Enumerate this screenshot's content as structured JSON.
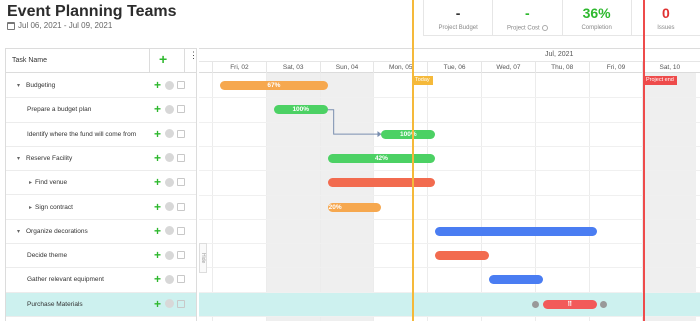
{
  "header": {
    "title": "Event Planning Teams",
    "date_range": "Jul 06, 2021 - Jul 09, 2021"
  },
  "stats": [
    {
      "value": "-",
      "label": "Project Budget",
      "color": "#333333"
    },
    {
      "value": "-",
      "label": "Project Cost",
      "color": "#2eb82e"
    },
    {
      "value": "36%",
      "label": "Completion",
      "color": "#2eb82e"
    },
    {
      "value": "0",
      "label": "Issues",
      "color": "#e03131"
    }
  ],
  "grid": {
    "header_label": "Task Name",
    "add_icon": "+",
    "menu_icon": "⋮",
    "rows": [
      {
        "name": "Budgeting",
        "level": 0,
        "caret": "▾"
      },
      {
        "name": "Prepare a budget plan",
        "level": 1,
        "caret": ""
      },
      {
        "name": "Identify where the fund will come from",
        "level": 1,
        "caret": ""
      },
      {
        "name": "Reserve Facility",
        "level": 0,
        "caret": "▾"
      },
      {
        "name": "Find venue",
        "level": 1,
        "caret": "▸"
      },
      {
        "name": "Sign contract",
        "level": 1,
        "caret": "▸"
      },
      {
        "name": "Organize decorations",
        "level": 0,
        "caret": "▾"
      },
      {
        "name": "Decide theme",
        "level": 1,
        "caret": ""
      },
      {
        "name": "Gather relevant equipment",
        "level": 1,
        "caret": ""
      },
      {
        "name": "Purchase Materials",
        "level": 1,
        "caret": "",
        "selected": true
      }
    ]
  },
  "timeline": {
    "month": "Jul, 2021",
    "days": [
      "Fri, 02",
      "Sat, 03",
      "Sun, 04",
      "Mon, 05",
      "Tue, 06",
      "Wed, 07",
      "Thu, 08",
      "Fri, 09",
      "Sat, 10"
    ],
    "weekend_days": [
      1,
      2,
      8
    ],
    "today_label": "Today",
    "project_end_label": "Project end",
    "hide_label": "Hide",
    "bars": [
      {
        "row": 0,
        "start": 0.15,
        "end": 2.15,
        "color": "orange",
        "label": "67%"
      },
      {
        "row": 1,
        "start": 1.15,
        "end": 2.15,
        "color": "green",
        "label": "100%"
      },
      {
        "row": 2,
        "start": 3.15,
        "end": 4.15,
        "color": "green",
        "label": "100%"
      },
      {
        "row": 3,
        "start": 2.15,
        "end": 4.15,
        "color": "green",
        "label": "42%"
      },
      {
        "row": 4,
        "start": 2.15,
        "end": 4.15,
        "color": "red",
        "label": ""
      },
      {
        "row": 5,
        "start": 2.15,
        "end": 3.15,
        "color": "orange",
        "label": "20%"
      },
      {
        "row": 6,
        "start": 4.15,
        "end": 7.15,
        "color": "blue",
        "label": ""
      },
      {
        "row": 7,
        "start": 4.15,
        "end": 5.15,
        "color": "red",
        "label": ""
      },
      {
        "row": 8,
        "start": 5.15,
        "end": 6.15,
        "color": "blue",
        "label": ""
      },
      {
        "row": 9,
        "start": 6.15,
        "end": 7.15,
        "color": "pink",
        "label": "⠿"
      }
    ]
  }
}
